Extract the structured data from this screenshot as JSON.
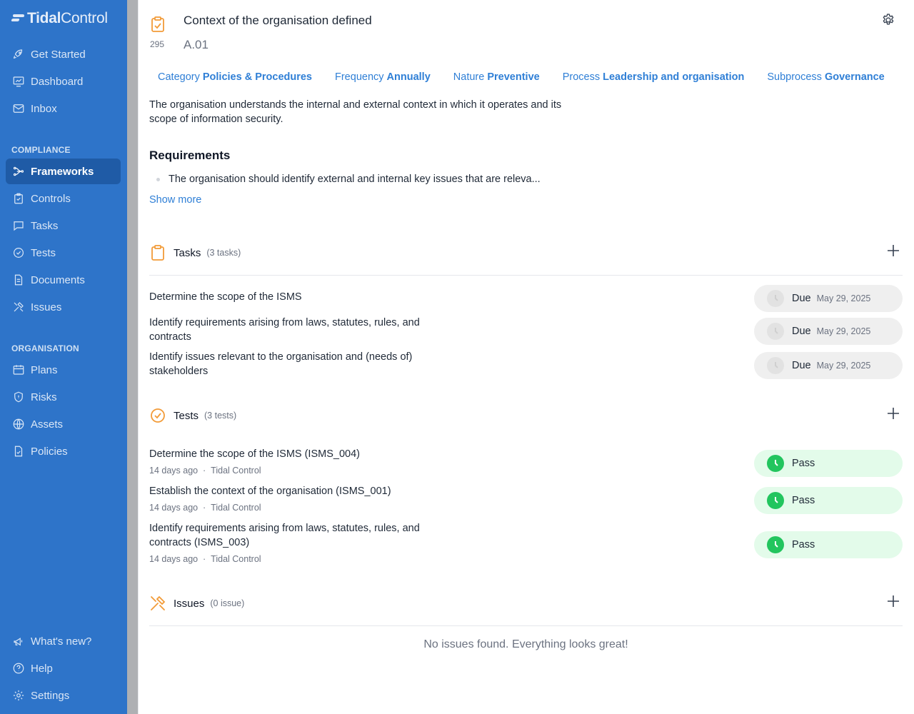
{
  "brand": {
    "name_bold": "Tidal",
    "name_light": "Control"
  },
  "sidebar": {
    "top_items": [
      {
        "label": "Get Started",
        "icon": "rocket-icon"
      },
      {
        "label": "Dashboard",
        "icon": "dashboard-icon"
      },
      {
        "label": "Inbox",
        "icon": "inbox-icon"
      }
    ],
    "compliance_label": "COMPLIANCE",
    "compliance_items": [
      {
        "label": "Frameworks",
        "icon": "frameworks-icon",
        "active": true
      },
      {
        "label": "Controls",
        "icon": "controls-icon"
      },
      {
        "label": "Tasks",
        "icon": "tasks-icon"
      },
      {
        "label": "Tests",
        "icon": "tests-icon"
      },
      {
        "label": "Documents",
        "icon": "documents-icon"
      },
      {
        "label": "Issues",
        "icon": "issues-icon"
      }
    ],
    "organisation_label": "ORGANISATION",
    "organisation_items": [
      {
        "label": "Plans",
        "icon": "calendar-icon"
      },
      {
        "label": "Risks",
        "icon": "shield-icon"
      },
      {
        "label": "Assets",
        "icon": "globe-icon"
      },
      {
        "label": "Policies",
        "icon": "policy-icon"
      }
    ],
    "bottom_items": [
      {
        "label": "What's new?",
        "icon": "megaphone-icon"
      },
      {
        "label": "Help",
        "icon": "help-icon"
      },
      {
        "label": "Settings",
        "icon": "gear-icon"
      }
    ]
  },
  "control": {
    "title": "Context of the organisation defined",
    "number": "295",
    "code": "A.01",
    "meta": [
      {
        "key": "Category",
        "value": "Policies & Procedures"
      },
      {
        "key": "Frequency",
        "value": "Annually"
      },
      {
        "key": "Nature",
        "value": "Preventive"
      },
      {
        "key": "Process",
        "value": "Leadership and organisation"
      },
      {
        "key": "Subprocess",
        "value": "Governance"
      }
    ],
    "description": "The organisation understands the internal and external context in which it operates and its scope of information security.",
    "requirements_title": "Requirements",
    "requirement": "The organisation should identify external and internal key issues that are releva...",
    "show_more": "Show more"
  },
  "tasks": {
    "title": "Tasks",
    "count": "(3 tasks)",
    "items": [
      {
        "text": "Determine the scope of the ISMS",
        "status": "Due",
        "date": "May 29, 2025"
      },
      {
        "text": "Identify requirements arising from laws, statutes, rules, and contracts",
        "status": "Due",
        "date": "May 29, 2025"
      },
      {
        "text": "Identify issues relevant to the organisation and (needs of) stakeholders",
        "status": "Due",
        "date": "May 29, 2025"
      }
    ]
  },
  "tests": {
    "title": "Tests",
    "count": "(3 tests)",
    "items": [
      {
        "text": "Determine the scope of the ISMS (ISMS_004)",
        "when": "14 days ago",
        "by": "Tidal Control",
        "status": "Pass"
      },
      {
        "text": "Establish the context of the organisation (ISMS_001)",
        "when": "14 days ago",
        "by": "Tidal Control",
        "status": "Pass"
      },
      {
        "text": "Identify requirements arising from laws, statutes, rules, and contracts (ISMS_003)",
        "when": "14 days ago",
        "by": "Tidal Control",
        "status": "Pass"
      }
    ]
  },
  "issues": {
    "title": "Issues",
    "count": "(0 issue)",
    "empty": "No issues found. Everything looks great!"
  },
  "colors": {
    "sidebar": "#2e74c9",
    "accent": "#2f7fd6",
    "orange": "#f29b38",
    "pass": "#22c55e"
  }
}
